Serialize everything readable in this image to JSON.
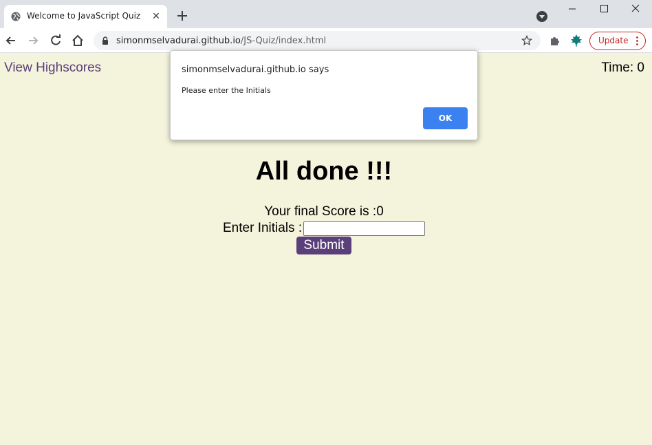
{
  "browser": {
    "tab_title": "Welcome to JavaScript Quiz",
    "tab_close": "✕",
    "url_host": "simonmselvadurai.github.io",
    "url_path": "/JS-Quiz/index.html",
    "update_label": "Update",
    "colors": {
      "tabstrip": "#dee1e6",
      "update": "#c5221f",
      "leaf": "#0f7b7b"
    }
  },
  "page": {
    "view_highscores": "View Highscores",
    "timer": "Time: 0",
    "title": "All done !!!",
    "score_line": "Your final Score is :0",
    "initials_label": "Enter Initials :",
    "initials_value": "",
    "submit_label": "Submit",
    "colors": {
      "background": "#f4f3dc",
      "accent": "#5a3f7a"
    }
  },
  "dialog": {
    "title": "simonmselvadurai.github.io says",
    "message": "Please enter the Initials",
    "ok_label": "OK",
    "colors": {
      "ok": "#3b82f0"
    }
  }
}
